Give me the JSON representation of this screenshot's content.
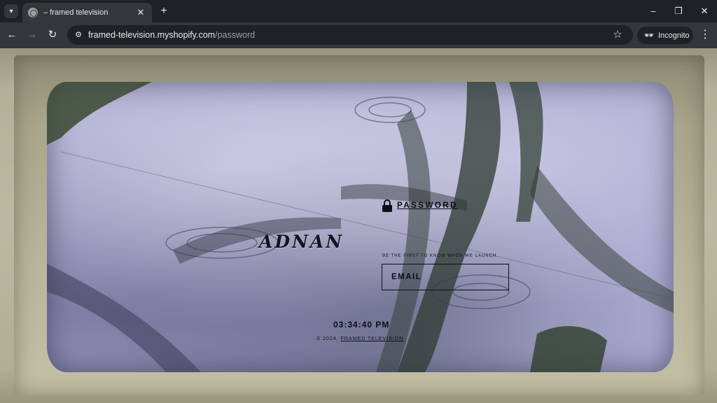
{
  "browser": {
    "tab": {
      "title": "– framed television",
      "close_glyph": "✕"
    },
    "newtab_glyph": "+",
    "window_controls": {
      "minimize": "–",
      "restore": "❐",
      "close": "✕"
    },
    "nav": {
      "back": "←",
      "forward": "→",
      "reload": "↻"
    },
    "url": {
      "host": "framed-television.myshopify.com",
      "path": "/password"
    },
    "incognito_label": "Incognito",
    "menu_glyph": "⋮",
    "star_glyph": "☆"
  },
  "page": {
    "logo_text": "ADNAN",
    "password_link": "PASSWORD",
    "tagline": "BE THE FIRST TO KNOW WHEN WE LAUNCH.",
    "email_placeholder": "EMAIL",
    "clock": "03:34:40 PM",
    "copyright_prefix": "© 2024,",
    "copyright_link": "FRAMED TELEVISION"
  },
  "colors": {
    "chrome_dark": "#202124",
    "chrome_toolbar": "#35363a",
    "frame": "#b9b59b",
    "screen_tint": "#a9a8cd",
    "ink": "#0e0e16"
  }
}
